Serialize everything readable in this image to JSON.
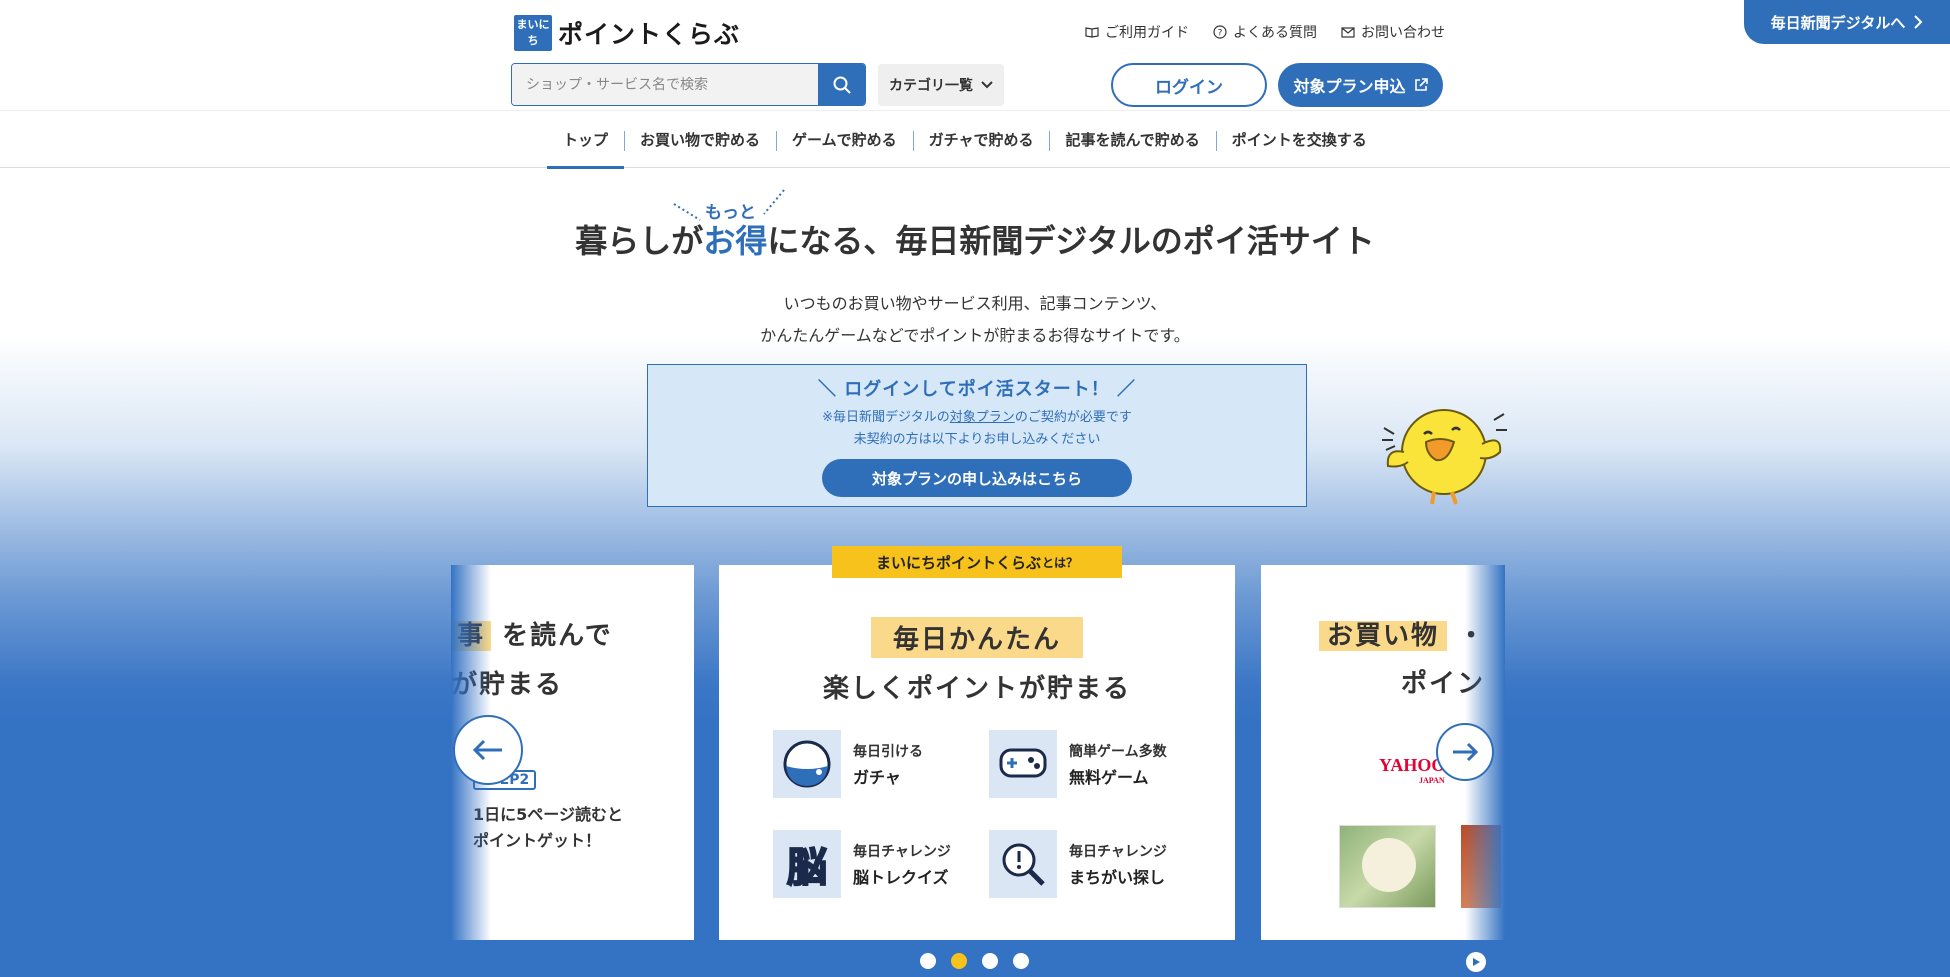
{
  "header": {
    "logo_mark": "まいにち",
    "logo_text": "ポイントくらぶ",
    "util_links": [
      {
        "label": "ご利用ガイド",
        "icon": "book-icon"
      },
      {
        "label": "よくある質問",
        "icon": "question-circle-icon"
      },
      {
        "label": "お問い合わせ",
        "icon": "mail-icon"
      }
    ],
    "digital_link": "毎日新聞デジタルへ",
    "search_placeholder": "ショップ・サービス名で検索",
    "category_label": "カテゴリ一覧",
    "login_label": "ログイン",
    "apply_label": "対象プラン申込"
  },
  "nav": {
    "items": [
      "トップ",
      "お買い物で貯める",
      "ゲームで貯める",
      "ガチャで貯める",
      "記事を読んで貯める",
      "ポイントを交換する"
    ],
    "active_index": 0
  },
  "hero": {
    "motto": "もっと",
    "title_before": "暮らしが",
    "title_highlight": "お得",
    "title_after": "になる、毎日新聞デジタルのポイ活サイト",
    "desc_line1": "いつものお買い物やサービス利用、記事コンテンツ、",
    "desc_line2": "かんたんゲームなどでポイントが貯まるお得なサイトです。"
  },
  "login_panel": {
    "title": "＼ ログインしてポイ活スタート！ ／",
    "note_before": "※毎日新聞デジタルの",
    "note_link": "対象プラン",
    "note_after": "のご契約が必要です",
    "note_line2": "未契約の方は以下よりお申し込みください",
    "button": "対象プランの申し込みはこちら"
  },
  "about_tag": {
    "main": "まいにちポイントくらぶ",
    "small": "とは？"
  },
  "carousel": {
    "left_card": {
      "line1_hl": "事",
      "line1_rest": "を読んで",
      "line2": "が貯まる",
      "step": "STEP2",
      "step_line1": "1日に5ページ読むと",
      "step_line2": "ポイントゲット！"
    },
    "center_card": {
      "label": "毎日かんたん",
      "sub": "楽しくポイントが貯まる",
      "features": [
        {
          "small": "毎日引ける",
          "big": "ガチャ",
          "icon": "gacha-ball-icon"
        },
        {
          "small": "簡単ゲーム多数",
          "big": "無料ゲーム",
          "icon": "gamepad-icon"
        },
        {
          "small": "毎日チャレンジ",
          "big": "脳トレクイズ",
          "icon": "brain-quiz-icon"
        },
        {
          "small": "毎日チャレンジ",
          "big": "まちがい探し",
          "icon": "magnifier-icon"
        }
      ]
    },
    "right_card": {
      "label": "お買い物",
      "label_rest": "・",
      "sub": "ポイン",
      "logo_text": "YAHOO!",
      "logo_sub": "JAPAN"
    },
    "dots": 4,
    "active_dot": 1
  },
  "colors": {
    "brand": "#2f6fb9",
    "accent": "#f6c21b",
    "highlight": "#fbd98a"
  }
}
